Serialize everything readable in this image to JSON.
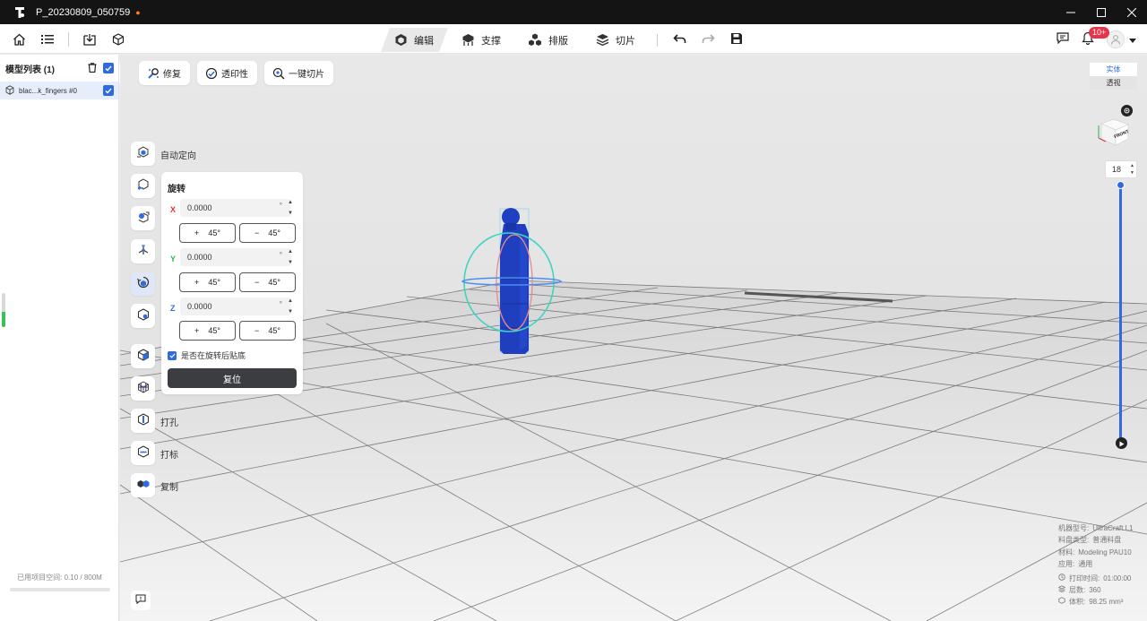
{
  "window": {
    "title": "P_20230809_050759",
    "unsaved_mark": "●"
  },
  "toolbar": {
    "tabs": [
      {
        "label": "编辑",
        "icon": "edit-cube-icon",
        "active": true
      },
      {
        "label": "支撑",
        "icon": "support-icon",
        "active": false
      },
      {
        "label": "排版",
        "icon": "layout-icon",
        "active": false
      },
      {
        "label": "切片",
        "icon": "slice-layers-icon",
        "active": false
      }
    ],
    "notification_badge": "10+"
  },
  "left_panel": {
    "title": "模型列表 (1)",
    "models": [
      {
        "name": "blac...k_fingers #0",
        "checked": true
      }
    ],
    "storage_text": "已用项目空间: 0.10 / 800M"
  },
  "top_tools": [
    {
      "label": "修复",
      "icon": "repair-icon"
    },
    {
      "label": "透印性",
      "icon": "printability-icon"
    },
    {
      "label": "一键切片",
      "icon": "one-click-slice-icon"
    }
  ],
  "side_tools": [
    {
      "label": "自动定向",
      "icon": "auto-orient-icon"
    },
    {
      "label": "",
      "icon": "move-icon"
    },
    {
      "label": "",
      "icon": "scale-icon"
    },
    {
      "label": "",
      "icon": "mirror-icon"
    },
    {
      "label": "",
      "icon": "rotate-icon"
    },
    {
      "label": "",
      "icon": "hollow-icon"
    },
    {
      "label": "",
      "icon": "solid-cube-icon"
    },
    {
      "label": "",
      "icon": "lattice-cube-icon"
    },
    {
      "label": "打孔",
      "icon": "punch-hole-icon"
    },
    {
      "label": "打标",
      "icon": "label-icon"
    },
    {
      "label": "复制",
      "icon": "copy-icon"
    }
  ],
  "rotate_panel": {
    "title": "旋转",
    "axes": [
      {
        "axis": "X",
        "value": "0.0000",
        "color": "#e5322d"
      },
      {
        "axis": "Y",
        "value": "0.0000",
        "color": "#2ab34a"
      },
      {
        "axis": "Z",
        "value": "0.0000",
        "color": "#2f6bdf"
      }
    ],
    "deg_symbol": "°",
    "plus_label": "+",
    "minus_label": "−",
    "step_label": "45°",
    "drop_after_rotate_label": "是否在旋转后贴底",
    "drop_after_rotate_checked": true,
    "reset_label": "复位"
  },
  "view_mode": {
    "solid": "实体",
    "transparent": "透视"
  },
  "view_cube_label": "FRONT",
  "layer_value": "18",
  "info": {
    "machine_label": "机器型号:",
    "machine_value": "UltraCraft L1",
    "tray_label": "料盘类型:",
    "tray_value": "普通料盘",
    "material_label": "材料:",
    "material_value": "Modeling PAU10",
    "application_label": "应用:",
    "application_value": "通用",
    "print_time_label": "打印时间:",
    "print_time_value": "01:00:00",
    "layers_label": "层数:",
    "layers_value": "360",
    "volume_label": "体积:",
    "volume_value": "98.25 mm³"
  },
  "colors": {
    "accent": "#2f6bdf",
    "model": "#1f3fbf",
    "titlebar": "#141414",
    "badge": "#e6344a"
  }
}
